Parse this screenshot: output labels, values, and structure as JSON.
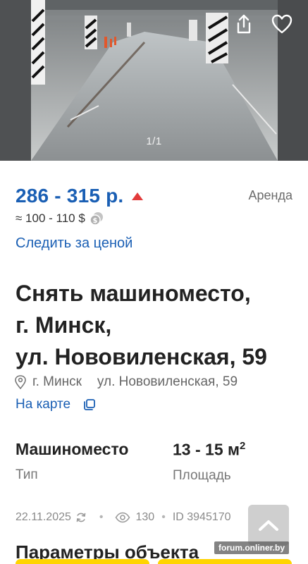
{
  "gallery": {
    "counter": "1/1",
    "share_icon": "share-icon",
    "favorite_icon": "heart-icon"
  },
  "price": {
    "range": "286 - 315 р.",
    "usd": "≈ 100 - 110 $",
    "deal_type": "Аренда",
    "track_label": "Следить за ценой",
    "trend": "up",
    "trend_color": "#e23b3b",
    "accent": "#1a5fb4"
  },
  "listing": {
    "title_lines": [
      "Снять машиноместо,",
      "г. Минск,",
      "ул. Нововиленская, 59"
    ],
    "address_city": "г. Минск",
    "address_street": "ул. Нововиленская, 59",
    "map_link": "На карте"
  },
  "specs": {
    "type_value": "Машиноместо",
    "type_label": "Тип",
    "area_value": "13 - 15 м",
    "area_sup": "2",
    "area_label": "Площадь"
  },
  "meta": {
    "date": "22.11.2025",
    "views": "130",
    "id": "ID 3945170"
  },
  "section_title": "Параметры объекта",
  "watermark": "forum.onliner.by"
}
